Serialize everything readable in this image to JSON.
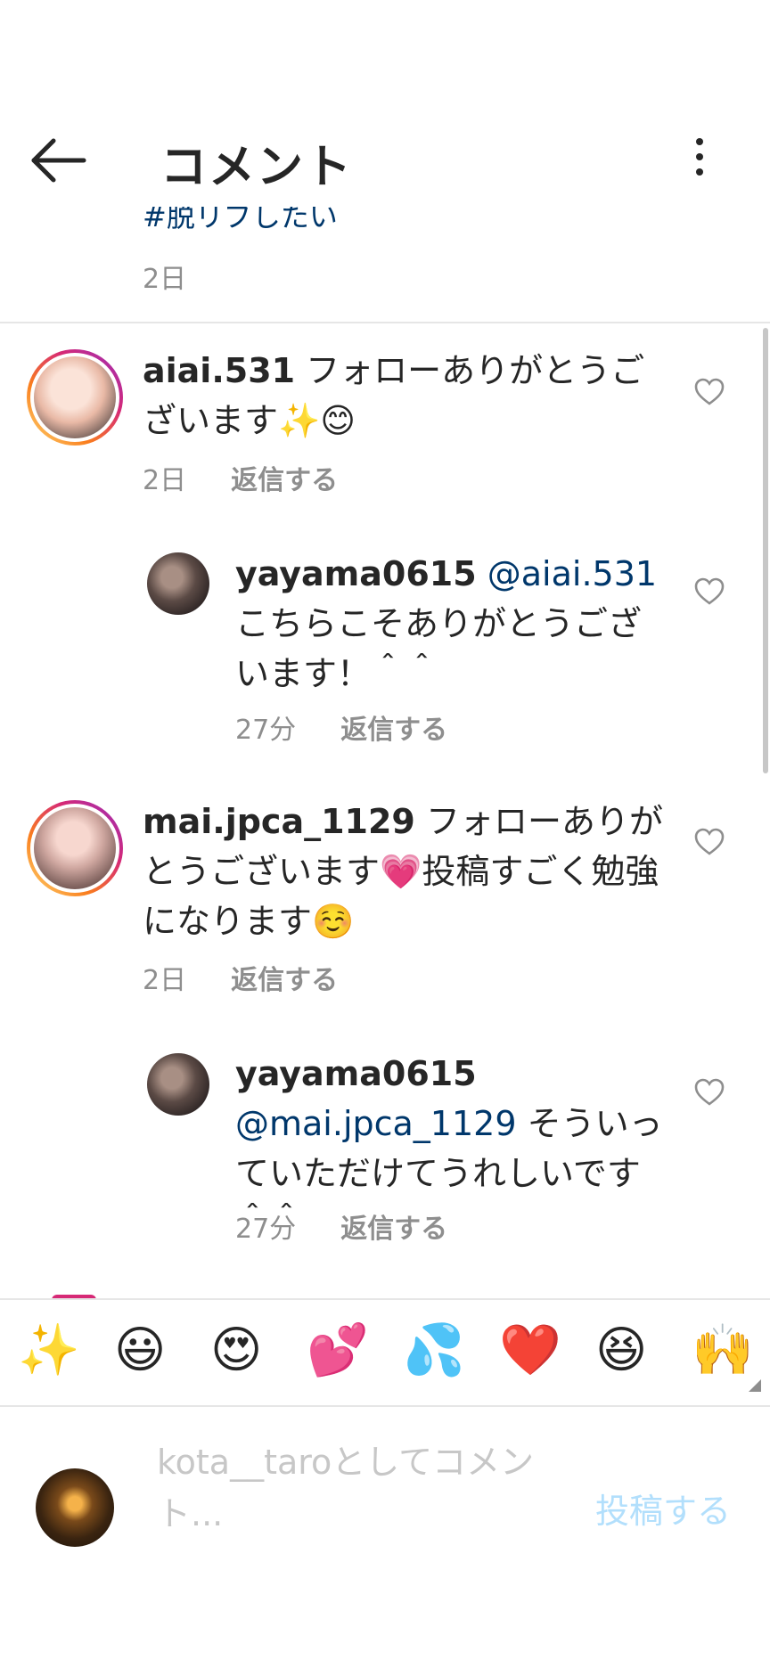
{
  "header": {
    "title": "コメント"
  },
  "caption": {
    "tail_text": "#脱リブしたい",
    "time": "2日"
  },
  "comments": [
    {
      "username": "aiai.531",
      "text": " フォローありがとうございます✨😊",
      "time": "2日",
      "reply_label": "返信する"
    },
    {
      "username": "yayama0615",
      "mention": "@aiai.531",
      "text": " こちらこそありがとうございます！＾＾",
      "time": "27分",
      "reply_label": "返信する"
    },
    {
      "username": "mai.jpca_1129",
      "text": " フォローありがとうございます💗投稿すごく勉強になります☺️",
      "time": "2日",
      "reply_label": "返信する"
    },
    {
      "username": "yayama0615",
      "mention": "@mai.jpca_1129",
      "text": " そういっていただけてうれしいです＾＾",
      "time": "27分",
      "reply_label": "返信する"
    }
  ],
  "emoji_bar": [
    "✨",
    "😃",
    "😍",
    "💕",
    "💦",
    "❤️",
    "😆",
    "🙌"
  ],
  "composer": {
    "placeholder": "kota__taroとしてコメント...",
    "post_label": "投稿する"
  },
  "colors": {
    "link": "#00376b",
    "muted": "#8e8e8e",
    "post_disabled": "#b2dffc",
    "story_ring": "#d62976"
  }
}
